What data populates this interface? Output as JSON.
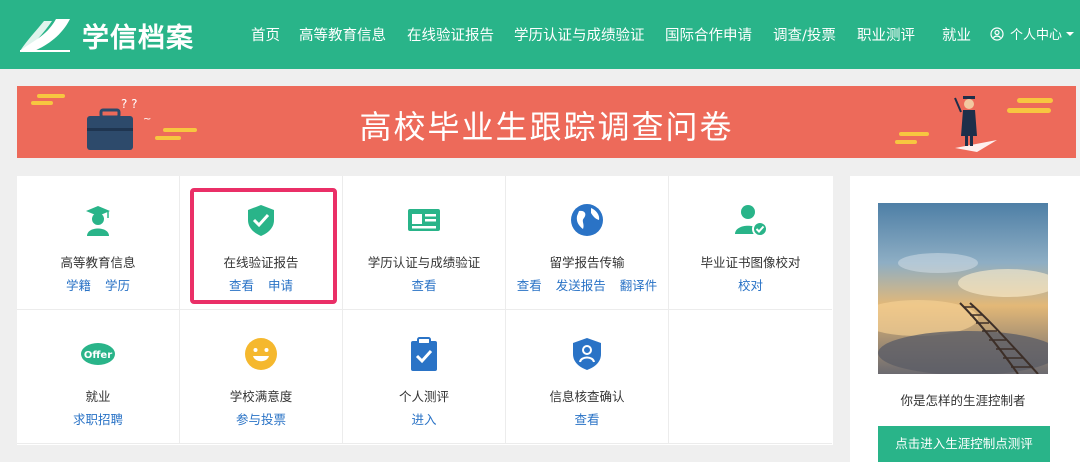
{
  "header": {
    "logo_text": "学信档案",
    "nav": [
      "首页",
      "高等教育信息",
      "在线验证报告",
      "学历认证与成绩验证",
      "国际合作申请",
      "调查/投票",
      "职业测评",
      "就业"
    ],
    "user_center": "个人中心",
    "brand_color": "#29b489"
  },
  "banner": {
    "title": "高校毕业生跟踪调查问卷",
    "color": "#ed6a5a"
  },
  "services": [
    {
      "title": "高等教育信息",
      "links": [
        "学籍",
        "学历"
      ],
      "icon": "student-cap-icon"
    },
    {
      "title": "在线验证报告",
      "links": [
        "查看",
        "申请"
      ],
      "icon": "shield-check-icon"
    },
    {
      "title": "学历认证与成绩验证",
      "links": [
        "查看"
      ],
      "icon": "id-card-icon"
    },
    {
      "title": "留学报告传输",
      "links": [
        "查看",
        "发送报告",
        "翻译件"
      ],
      "icon": "globe-icon"
    },
    {
      "title": "毕业证书图像校对",
      "links": [
        "校对"
      ],
      "icon": "user-check-icon"
    },
    {
      "title": "就业",
      "links": [
        "求职招聘"
      ],
      "icon": "offer-icon"
    },
    {
      "title": "学校满意度",
      "links": [
        "参与投票"
      ],
      "icon": "smiley-icon"
    },
    {
      "title": "个人测评",
      "links": [
        "进入"
      ],
      "icon": "clipboard-check-icon"
    },
    {
      "title": "信息核查确认",
      "links": [
        "查看"
      ],
      "icon": "shield-user-icon"
    }
  ],
  "side": {
    "caption": "你是怎样的生涯控制者",
    "button": "点击进入生涯控制点测评"
  },
  "link_color": "#2a73c6",
  "highlight_color": "#ea2f67"
}
